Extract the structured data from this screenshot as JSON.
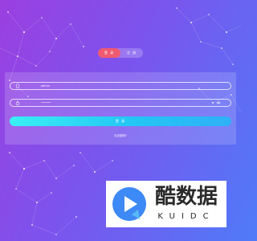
{
  "tabs": [
    {
      "label": "登 录",
      "active": true
    },
    {
      "label": "注 册",
      "active": false
    }
  ],
  "form": {
    "username": {
      "icon": "phone-icon",
      "value": "admin"
    },
    "password": {
      "icon": "lock-icon",
      "value": "••••••",
      "toggle_icon": "eye-icon"
    },
    "login_label": "登 录",
    "forgot_label": "忘记密码?"
  },
  "watermark": {
    "name": "酷数据",
    "sub": "KUIDC",
    "colors": {
      "mark": "#3d89f5",
      "accent": "#59b8f8",
      "text": "#2a2a2a"
    }
  },
  "colors": {
    "bg_start": "#9b3fe0",
    "bg_end": "#4f7bf8",
    "tab_active": "#ef5a72",
    "button_start": "#3af0f3",
    "button_end": "#2fb0f6"
  }
}
